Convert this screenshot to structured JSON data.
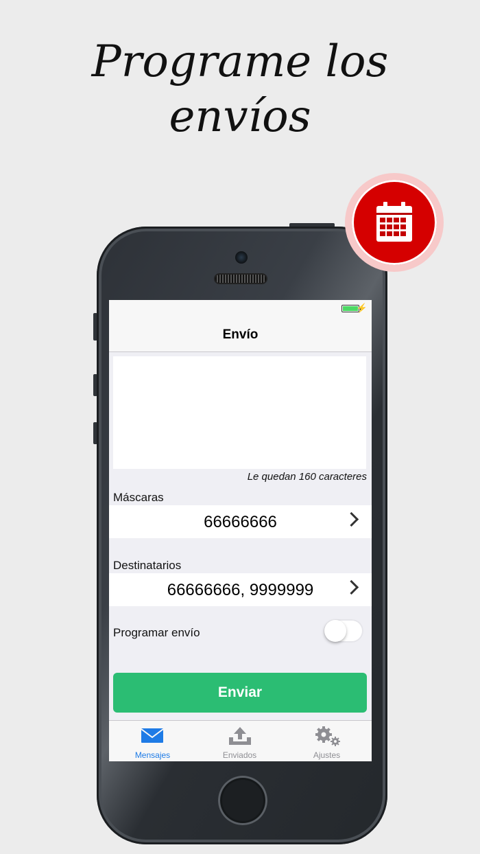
{
  "promo": {
    "headline_line1": "Programe los",
    "headline_line2": "envíos"
  },
  "colors": {
    "accent_green": "#2bbd73",
    "badge_red": "#d50000",
    "tab_active": "#1e7be6",
    "tab_inactive": "#8e8e93",
    "battery": "#4cd964"
  },
  "status_bar": {
    "battery_icon": "battery-charging-icon",
    "bolt_glyph": "⚡"
  },
  "nav": {
    "title": "Envío"
  },
  "message": {
    "value": "",
    "counter": "Le quedan 160 caracteres"
  },
  "masks": {
    "label": "Máscaras",
    "value": "66666666"
  },
  "recipients": {
    "label": "Destinatarios",
    "value": "66666666, 9999999"
  },
  "schedule": {
    "label": "Programar envío",
    "enabled": false
  },
  "send_button": {
    "label": "Enviar"
  },
  "tabs": [
    {
      "label": "Mensajes",
      "icon": "envelope-icon",
      "active": true
    },
    {
      "label": "Enviados",
      "icon": "upload-tray-icon",
      "active": false
    },
    {
      "label": "Ajustes",
      "icon": "gears-icon",
      "active": false
    }
  ],
  "badge": {
    "icon": "calendar-icon"
  }
}
